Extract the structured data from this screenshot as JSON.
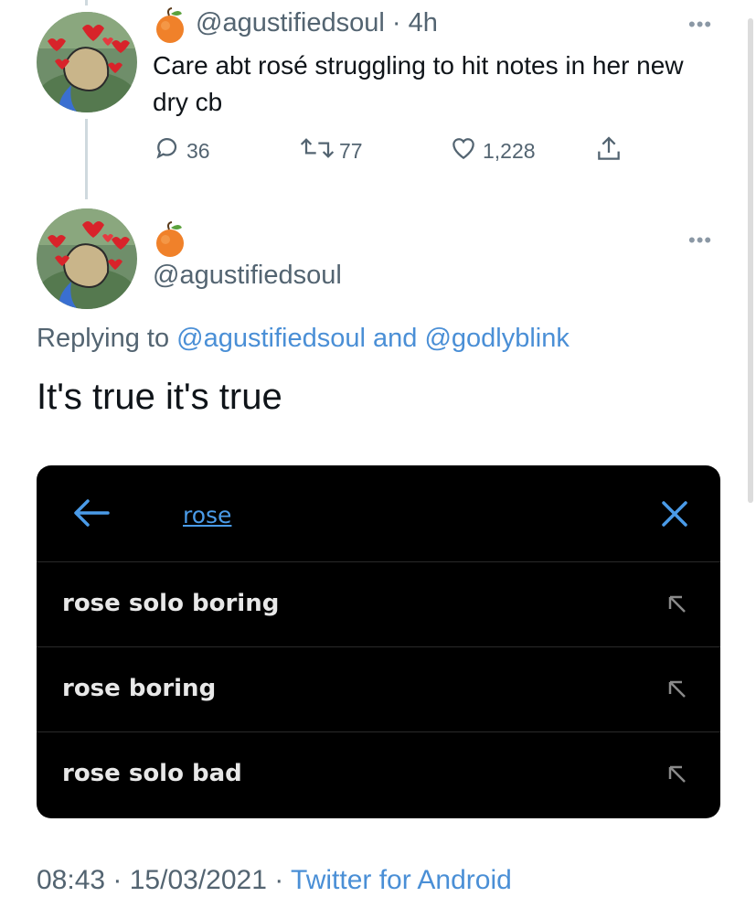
{
  "tweet1": {
    "handle": "@agustifiedsoul",
    "time": "4h",
    "text": "Care abt rosé struggling to hit notes in her new dry cb",
    "replies": "36",
    "retweets": "77",
    "likes": "1,228",
    "emoji": "🍑"
  },
  "tweet2": {
    "handle": "@agustifiedsoul",
    "replying_prefix": "Replying to ",
    "reply_to_1": "@agustifiedsoul",
    "reply_and": " and ",
    "reply_to_2": "@godlyblink",
    "text": "It's true it's true",
    "footer_time": "08:43",
    "footer_date": "15/03/2021",
    "footer_source": "Twitter for Android"
  },
  "search_card": {
    "query": "rose",
    "suggestions": [
      "rose solo boring",
      "rose boring",
      "rose solo bad"
    ]
  },
  "colors": {
    "link": "#4a8fd6",
    "muted": "#536471",
    "card_bg": "#000000"
  }
}
